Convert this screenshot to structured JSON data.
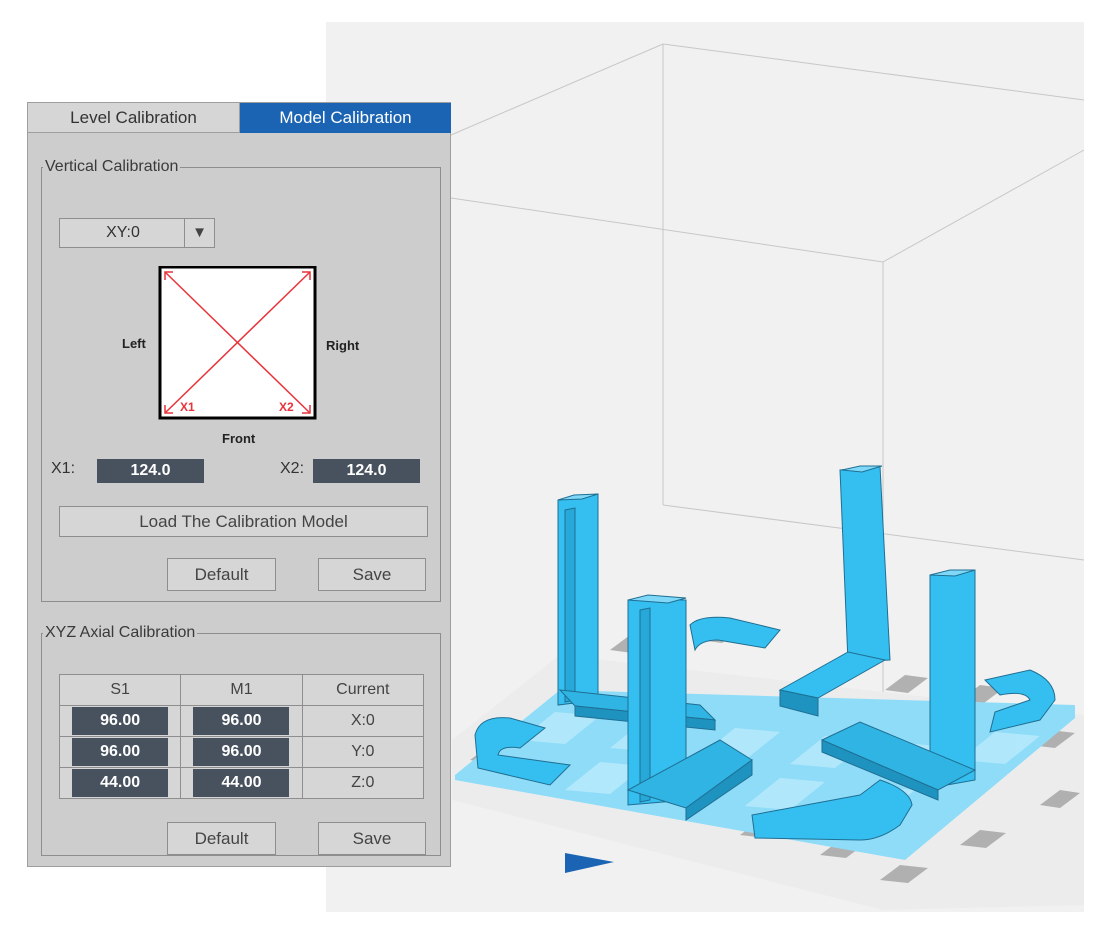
{
  "tabs": {
    "level": "Level Calibration",
    "model": "Model Calibration"
  },
  "vertical": {
    "legend": "Vertical Calibration",
    "select_value": "XY:0",
    "diagram": {
      "left": "Left",
      "right": "Right",
      "front": "Front",
      "x1": "X1",
      "x2": "X2"
    },
    "x1_label": "X1:",
    "x1_value": "124.0",
    "x2_label": "X2:",
    "x2_value": "124.0",
    "load_button": "Load The Calibration Model",
    "default_button": "Default",
    "save_button": "Save"
  },
  "xyz": {
    "legend": "XYZ Axial Calibration",
    "headers": [
      "S1",
      "M1",
      "Current"
    ],
    "rows": [
      {
        "s1": "96.00",
        "m1": "96.00",
        "current": "X:0"
      },
      {
        "s1": "96.00",
        "m1": "96.00",
        "current": "Y:0"
      },
      {
        "s1": "44.00",
        "m1": "44.00",
        "current": "Z:0"
      }
    ],
    "default_button": "Default",
    "save_button": "Save"
  },
  "colors": {
    "accent": "#1b64b4",
    "model": "#35bff0",
    "bed": "#8fdcf8",
    "diagonals": "#e8333a"
  }
}
